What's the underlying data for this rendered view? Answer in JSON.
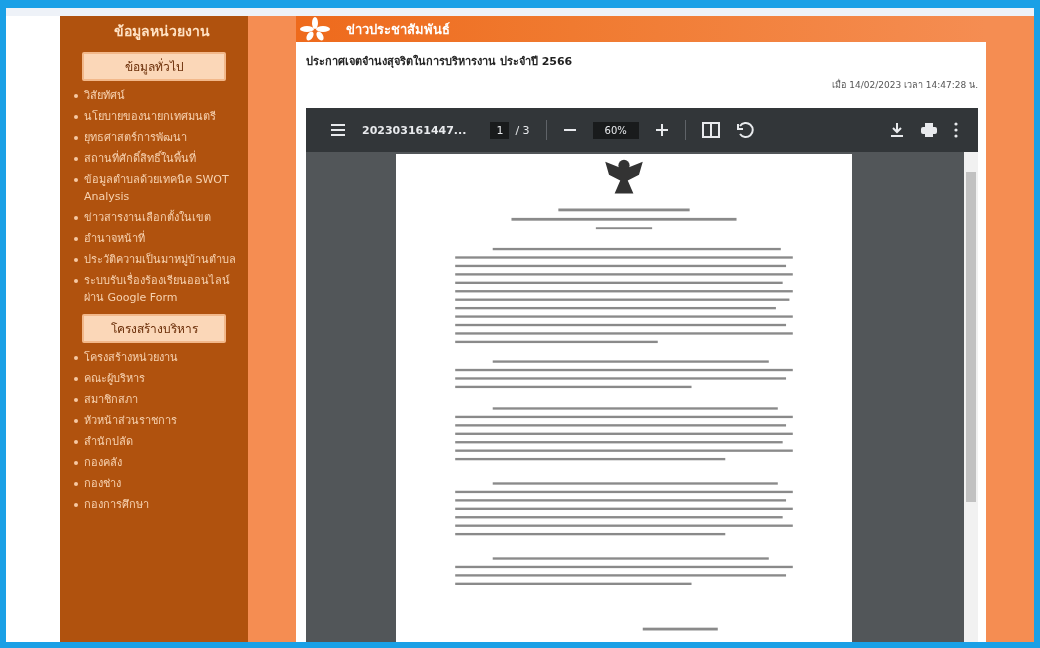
{
  "sidebar": {
    "title": "ข้อมูลหน่วยงาน",
    "sections": [
      {
        "heading": "ข้อมูลทั่วไป",
        "items": [
          "วิสัยทัศน์",
          "นโยบายของนายกเทศมนตรี",
          "ยุทธศาสตร์การพัฒนา",
          "สถานที่ศักดิ์สิทธิ์ในพื้นที่",
          "ข้อมูลตำบลด้วยเทคนิค SWOT Analysis",
          "ข่าวสารงานเลือกตั้งในเขต",
          "อำนาจหน้าที่",
          "ประวัติความเป็นมาหมู่บ้านตำบล",
          "ระบบรับเรื่องร้องเรียนออนไลน์ ผ่าน Google Form"
        ]
      },
      {
        "heading": "โครงสร้างบริหาร",
        "items": [
          "โครงสร้างหน่วยงาน",
          "คณะผู้บริหาร",
          "สมาชิกสภา",
          "หัวหน้าส่วนราชการ",
          "สำนักปลัด",
          "กองคลัง",
          "กองช่าง",
          "กองการศึกษา"
        ]
      }
    ]
  },
  "news": {
    "header": "ข่าวประชาสัมพันธ์",
    "title": "ประกาศเจตจำนงสุจริตในการบริหารงาน ประจำปี 2566",
    "posted": "เมื่อ 14/02/2023 เวลา 14:47:28 น."
  },
  "pdf_viewer": {
    "file_name": "202303161447...",
    "page": "1",
    "page_total": "/ 3",
    "zoom": "60%"
  }
}
